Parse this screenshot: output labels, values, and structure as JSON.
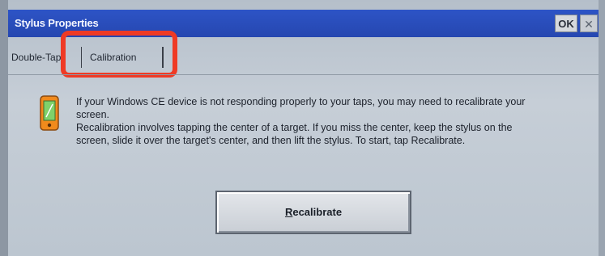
{
  "window": {
    "title": "Stylus Properties",
    "ok_label": "OK",
    "close_label": "✕"
  },
  "tabs": [
    {
      "label": "Double-Tap"
    },
    {
      "label": "Calibration",
      "selected": true
    }
  ],
  "content": {
    "icon": "pocket-device-icon",
    "paragraph1": "If your Windows CE device is not responding properly to your taps, you may need to recalibrate your screen.",
    "paragraph2": "Recalibration involves tapping the center of a target. If you miss the center, keep the stylus on the screen, slide it over the target's center, and then lift the stylus. To start, tap Recalibrate."
  },
  "recalibrate_button": {
    "label_first": "R",
    "label_rest": "ecalibrate"
  },
  "colors": {
    "titlebar": "#2d54c6",
    "highlight": "#ef3a25",
    "background": "#c6ced7"
  }
}
